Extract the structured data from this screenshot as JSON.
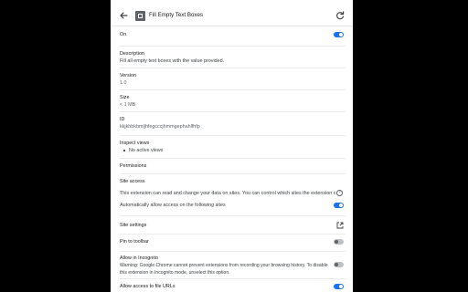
{
  "header": {
    "title": "Fill Empty Text Boxes",
    "back_icon": "arrow-back-icon",
    "extension_icon": "puzzle-icon",
    "reload_icon": "reload-icon"
  },
  "on": {
    "label": "On",
    "enabled": true
  },
  "description": {
    "label": "Description",
    "value": "Fill all empty text boxes with the value provided."
  },
  "version": {
    "label": "Version",
    "value": "1.0"
  },
  "size": {
    "label": "Size",
    "value": "< 1 MB"
  },
  "id": {
    "label": "ID",
    "value": "kkjkhbkbmljhfegcccjhmmgephahlfhfp"
  },
  "inspect_views": {
    "label": "Inspect views",
    "items": [
      "No active views"
    ]
  },
  "permissions": {
    "label": "Permissions"
  },
  "site_access": {
    "label": "Site access",
    "description": "This extension can read and change your data on sites. You can control which sites the extension can access.",
    "help_icon": "help-icon",
    "auto_allow_label": "Automatically allow access on the following sites",
    "auto_allow_enabled": true
  },
  "site_settings": {
    "label": "Site settings",
    "icon": "open-in-new-icon"
  },
  "pin_toolbar": {
    "label": "Pin to toolbar",
    "enabled": false
  },
  "incognito": {
    "label": "Allow in Incognito",
    "warning_line1": "Warning: Google Chrome cannot prevent extensions from recording your browsing history. To disable",
    "warning_line2": "this extension in Incognito mode, unselect this option.",
    "enabled": false
  },
  "file_urls": {
    "label": "Allow access to file URLs",
    "enabled": true
  },
  "colors": {
    "accent": "#1a73e8",
    "backdrop": "#000000",
    "panel": "#ffffff"
  }
}
